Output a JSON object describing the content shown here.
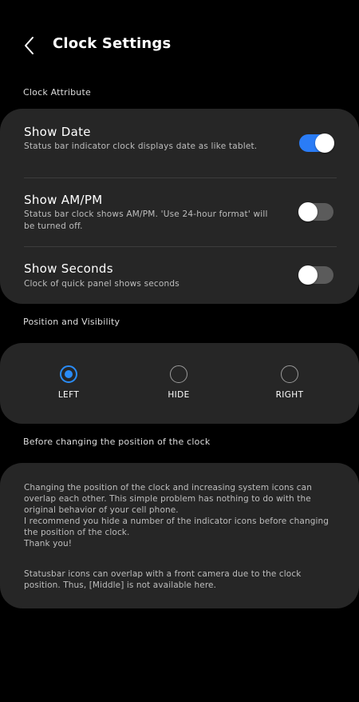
{
  "header": {
    "title": "Clock Settings",
    "back_icon": "chevron-left-icon"
  },
  "sections": {
    "clock_attribute": "Clock Attribute",
    "position_visibility": "Position and Visibility",
    "before_changing": "Before changing the position of the clock"
  },
  "settings": [
    {
      "title": "Show Date",
      "description": "Status bar indicator clock displays date as like tablet.",
      "enabled": true
    },
    {
      "title": "Show AM/PM",
      "description": "Status bar clock shows AM/PM. 'Use 24-hour format' will be turned off.",
      "enabled": false
    },
    {
      "title": "Show Seconds",
      "description": "Clock of quick panel shows seconds",
      "enabled": false
    }
  ],
  "position": {
    "options": [
      "LEFT",
      "HIDE",
      "RIGHT"
    ],
    "selected": "LEFT"
  },
  "info": {
    "paragraph1": "Changing the position of the clock and increasing system icons can overlap each other. This simple problem has nothing to do with the original behavior of your cell phone.\n I recommend you hide a number of the indicator icons before changing the position of the clock.\n Thank you!",
    "paragraph2": "Statusbar icons can overlap with a front camera due to the clock position. Thus, [Middle] is not available here."
  },
  "colors": {
    "background": "#000000",
    "card": "#262626",
    "accent": "#2a7cf6",
    "toggle_off": "#5b5b5b"
  }
}
